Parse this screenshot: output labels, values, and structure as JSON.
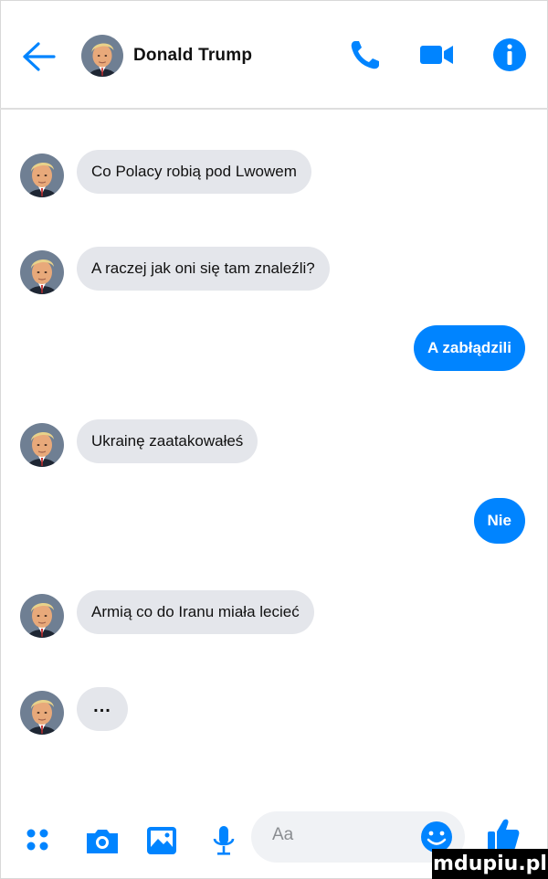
{
  "header": {
    "contact_name": "Donald Trump",
    "icons": [
      "back-arrow-icon",
      "phone-icon",
      "video-camera-icon",
      "info-icon"
    ]
  },
  "messages": [
    {
      "direction": "incoming",
      "text": "Co Polacy robią pod Lwowem"
    },
    {
      "direction": "incoming",
      "text": "A raczej jak oni się tam znaleźli?"
    },
    {
      "direction": "outgoing",
      "text": "A zabłądzili"
    },
    {
      "direction": "incoming",
      "text": "Ukrainę zaatakowałeś"
    },
    {
      "direction": "outgoing",
      "text": "Nie"
    },
    {
      "direction": "incoming",
      "text": "Armią co do Iranu miała lecieć"
    },
    {
      "direction": "incoming",
      "text": "..."
    }
  ],
  "composer": {
    "placeholder": "Aa",
    "icons": [
      "apps-icon",
      "camera-icon",
      "gallery-icon",
      "microphone-icon",
      "emoji-icon",
      "like-icon"
    ]
  },
  "colors": {
    "accent": "#0084ff",
    "incoming_bubble": "#e4e6eb",
    "outgoing_text": "#ffffff"
  },
  "watermark": "mdupiu.pl"
}
